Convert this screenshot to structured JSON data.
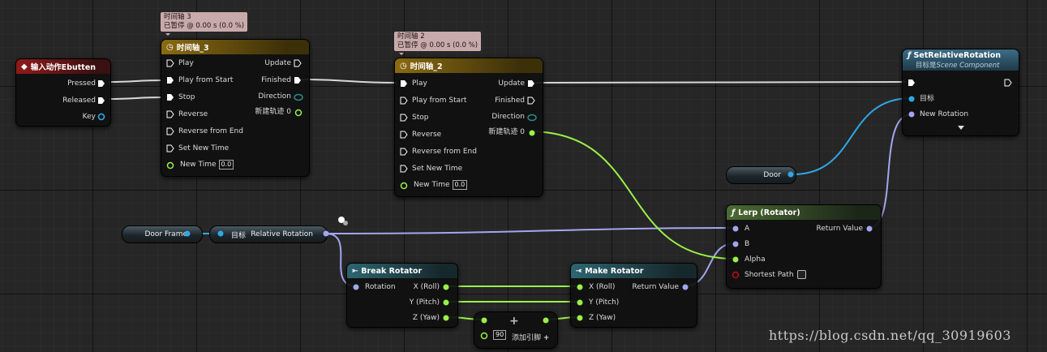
{
  "input_node": {
    "title": "输入动作Ebutten",
    "pins": {
      "pressed": "Pressed",
      "released": "Released",
      "key": "Key"
    }
  },
  "timeline3": {
    "caption1": "时间轴 3",
    "caption2": "已暂停 @ 0.00 s (0.0 %)",
    "title": "时间轴_3",
    "inputs": {
      "play": "Play",
      "play_from_start": "Play from Start",
      "stop": "Stop",
      "reverse": "Reverse",
      "reverse_from_end": "Reverse from End",
      "set_new_time": "Set New Time",
      "new_time": "New Time",
      "new_time_value": "0.0"
    },
    "outputs": {
      "update": "Update",
      "finished": "Finished",
      "direction": "Direction",
      "track": "新建轨迹 0"
    }
  },
  "timeline2": {
    "caption1": "时间轴 2",
    "caption2": "已暂停 @ 0.00 s (0.0 %)",
    "title": "时间轴_2",
    "inputs": {
      "play": "Play",
      "play_from_start": "Play from Start",
      "stop": "Stop",
      "reverse": "Reverse",
      "reverse_from_end": "Reverse from End",
      "set_new_time": "Set New Time",
      "new_time": "New Time",
      "new_time_value": "0.0"
    },
    "outputs": {
      "update": "Update",
      "finished": "Finished",
      "direction": "Direction",
      "track": "新建轨迹 0"
    }
  },
  "set_relative_rotation": {
    "title": "SetRelativeRotation",
    "subtitle_prefix": "目标是",
    "subtitle_target": "Scene Component",
    "target": "目标",
    "new_rotation": "New Rotation"
  },
  "door_var": {
    "label": "Door"
  },
  "door_frame_var": {
    "label": "Door Frame"
  },
  "get_rel_rot": {
    "target": "目标",
    "output": "Relative Rotation"
  },
  "lerp": {
    "title": "Lerp (Rotator)",
    "a": "A",
    "b": "B",
    "alpha": "Alpha",
    "shortest_path": "Shortest Path",
    "return_value": "Return Value"
  },
  "break_rotator": {
    "title": "Break Rotator",
    "rotation": "Rotation",
    "x": "X (Roll)",
    "y": "Y (Pitch)",
    "z": "Z (Yaw)"
  },
  "make_rotator": {
    "title": "Make Rotator",
    "x": "X (Roll)",
    "y": "Y (Pitch)",
    "z": "Z (Yaw)",
    "return_value": "Return Value"
  },
  "add_node": {
    "value": "90",
    "add_pin": "添加引脚"
  },
  "watermark": "https://blog.csdn.net/qq_30919603",
  "colors": {
    "exec": "#ffffff",
    "float": "#9af04a",
    "rotator": "#a2a6f0",
    "object": "#2fa8e8",
    "bool": "#b11",
    "wire_exec": "#d8d8d8"
  }
}
